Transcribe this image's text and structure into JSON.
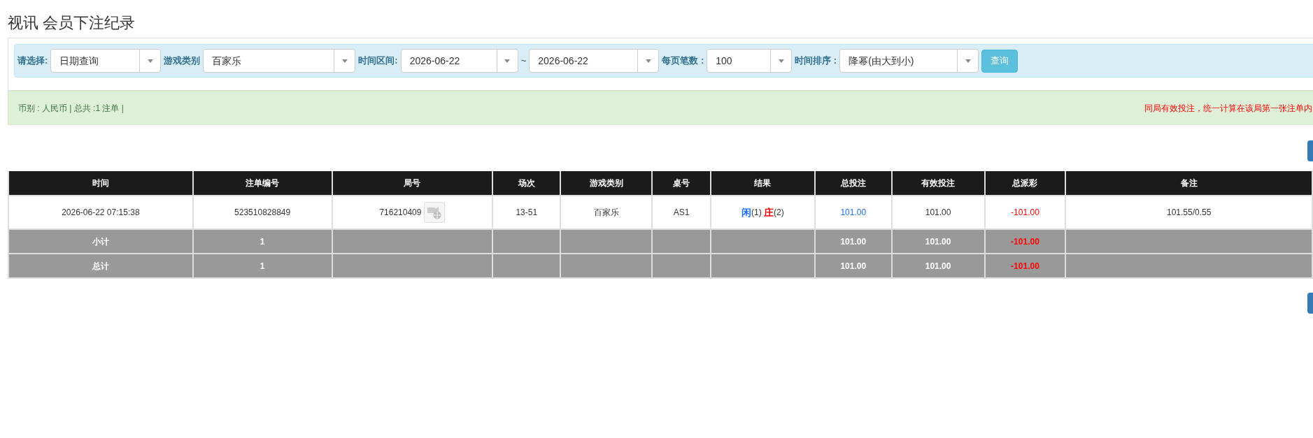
{
  "title": "视讯 会员下注纪录",
  "filters": [
    {
      "kind": "select",
      "label": "请选择:",
      "value": "日期查询"
    },
    {
      "kind": "select",
      "label": "游戏类别",
      "value": "百家乐"
    },
    {
      "kind": "select",
      "label": "时间区间:",
      "value": "2026-06-22"
    },
    {
      "kind": "separator",
      "label": "~"
    },
    {
      "kind": "select",
      "value": "2026-06-22"
    },
    {
      "kind": "select",
      "label": "每页笔数 :",
      "value": "100"
    },
    {
      "kind": "select",
      "label": "时间排序 :",
      "value": "降幂(由大到小)"
    },
    {
      "kind": "button",
      "label": "查询"
    }
  ],
  "summary": {
    "text": "币别 : 人民币 | 总共 :1 注单 |",
    "notice": "同局有效投注，统一计算在该局第一张注单内"
  },
  "table": {
    "columns": [
      "时间",
      "注单编号",
      "局号",
      "场次",
      "游戏类别",
      "桌号",
      "结果",
      "总投注",
      "有效投注",
      "总派彩",
      "备注"
    ],
    "rows": [
      {
        "kind": "data",
        "cells": [
          {
            "text": "2026-06-22 07:15:38"
          },
          {
            "text": "523510828849"
          },
          {
            "text": "716210409",
            "video": true
          },
          {
            "text": "13-51"
          },
          {
            "text": "百家乐"
          },
          {
            "text": "AS1"
          },
          {
            "parts": [
              {
                "text": "闲",
                "color": "#1e6fff"
              },
              {
                "text": "(1) "
              },
              {
                "text": "庄",
                "color": "#ff0000"
              },
              {
                "text": "(2)"
              }
            ]
          },
          {
            "text": "101.00",
            "color": "#1e6fff"
          },
          {
            "text": "101.00"
          },
          {
            "text": "-101.00",
            "color": "#ff0000"
          },
          {
            "text": "101.55/0.55"
          }
        ]
      },
      {
        "kind": "summary",
        "cells": [
          {
            "text": "小计"
          },
          {
            "text": "1"
          },
          {},
          {},
          {},
          {},
          {},
          {
            "text": "101.00"
          },
          {
            "text": "101.00"
          },
          {
            "text": "-101.00",
            "color": "#ff0000"
          },
          {}
        ]
      },
      {
        "kind": "summary",
        "cells": [
          {
            "text": "总计"
          },
          {
            "text": "1"
          },
          {},
          {},
          {},
          {},
          {},
          {
            "text": "101.00"
          },
          {
            "text": "101.00"
          },
          {
            "text": "-101.00",
            "color": "#ff0000"
          },
          {}
        ]
      }
    ]
  }
}
